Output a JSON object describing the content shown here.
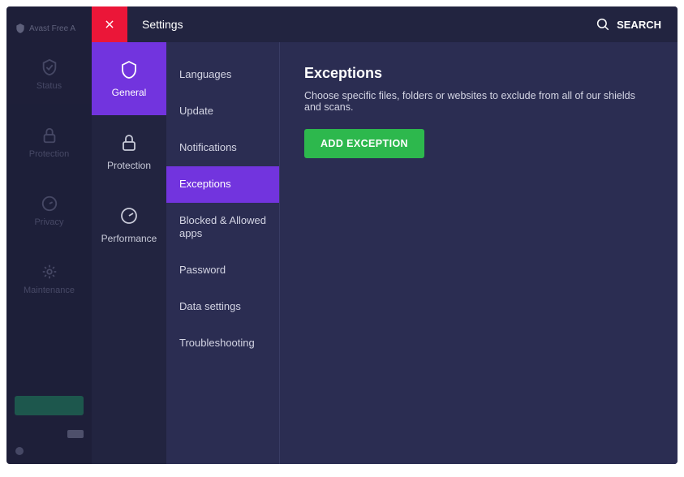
{
  "app_name": "Avast Free A",
  "header": {
    "title": "Settings",
    "search_label": "SEARCH"
  },
  "main_nav": {
    "items": [
      {
        "label": "Status"
      },
      {
        "label": "Protection"
      },
      {
        "label": "Privacy"
      },
      {
        "label": "Maintenance"
      }
    ]
  },
  "categories": [
    {
      "label": "General",
      "active": true
    },
    {
      "label": "Protection"
    },
    {
      "label": "Performance"
    }
  ],
  "sub_items": [
    {
      "label": "Languages"
    },
    {
      "label": "Update"
    },
    {
      "label": "Notifications"
    },
    {
      "label": "Exceptions",
      "active": true
    },
    {
      "label": "Blocked & Allowed apps"
    },
    {
      "label": "Password"
    },
    {
      "label": "Data settings"
    },
    {
      "label": "Troubleshooting"
    }
  ],
  "content": {
    "heading": "Exceptions",
    "description": "Choose specific files, folders or websites to exclude from all of our shields and scans.",
    "button_label": "ADD EXCEPTION"
  },
  "colors": {
    "accent": "#7234de",
    "close": "#eb1638",
    "primary_btn": "#2db84d",
    "bg_dark": "#222440",
    "bg_panel": "#2b2d52"
  }
}
